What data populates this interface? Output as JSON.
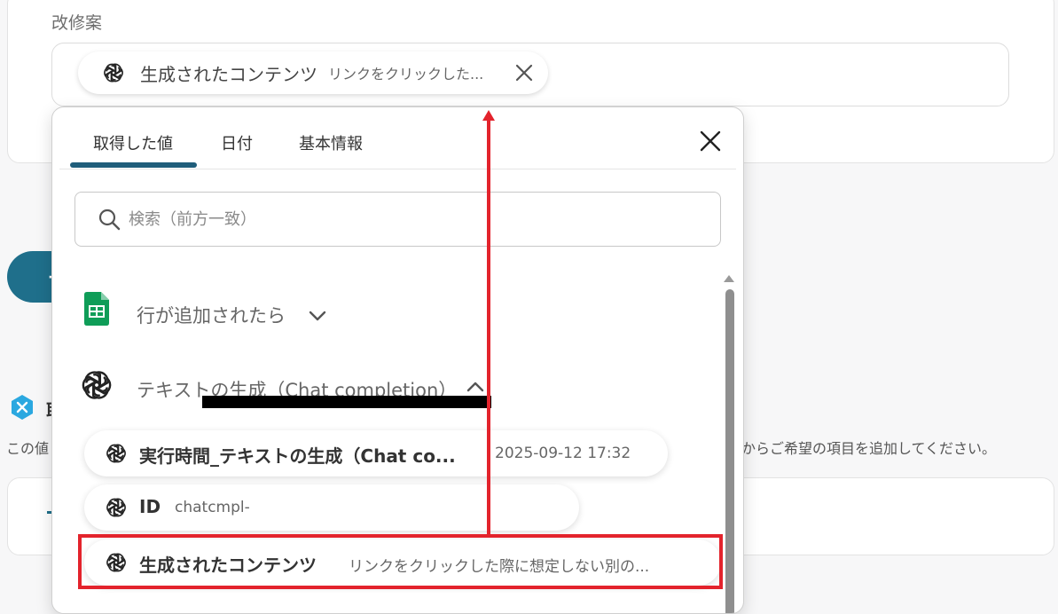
{
  "field": {
    "label": "改修案",
    "chip": {
      "title": "生成されたコンテンツ",
      "preview": "リンクをクリックした..."
    }
  },
  "background": {
    "run_button_label": "テ",
    "section_title": "取",
    "description_left": "この値",
    "description_right": "からご希望の項目を追加してください。"
  },
  "popup": {
    "tabs": [
      {
        "label": "取得した値",
        "active": true
      },
      {
        "label": "日付",
        "active": false
      },
      {
        "label": "基本情報",
        "active": false
      }
    ],
    "search": {
      "placeholder": "検索（前方一致）",
      "value": ""
    },
    "sections": [
      {
        "title": "行が追加されたら",
        "icon": "google-sheets-icon",
        "expanded": false
      },
      {
        "title": "テキストの生成（Chat completion）",
        "icon": "openai-icon",
        "expanded": true
      }
    ],
    "items": [
      {
        "label": "実行時間_テキストの生成（Chat co...",
        "value": "2025-09-12 17:32",
        "icon": "openai-icon"
      },
      {
        "label": "ID",
        "value": "chatcmpl-",
        "icon": "openai-icon",
        "redacted": true
      },
      {
        "label": "生成されたコンテンツ",
        "value": "リンクをクリックした際に想定しない別の...",
        "icon": "openai-icon",
        "highlighted": true
      }
    ]
  },
  "colors": {
    "accent": "#1f5d7a",
    "annotation_red": "#e3232c",
    "sheets_green": "#0f9d58"
  }
}
